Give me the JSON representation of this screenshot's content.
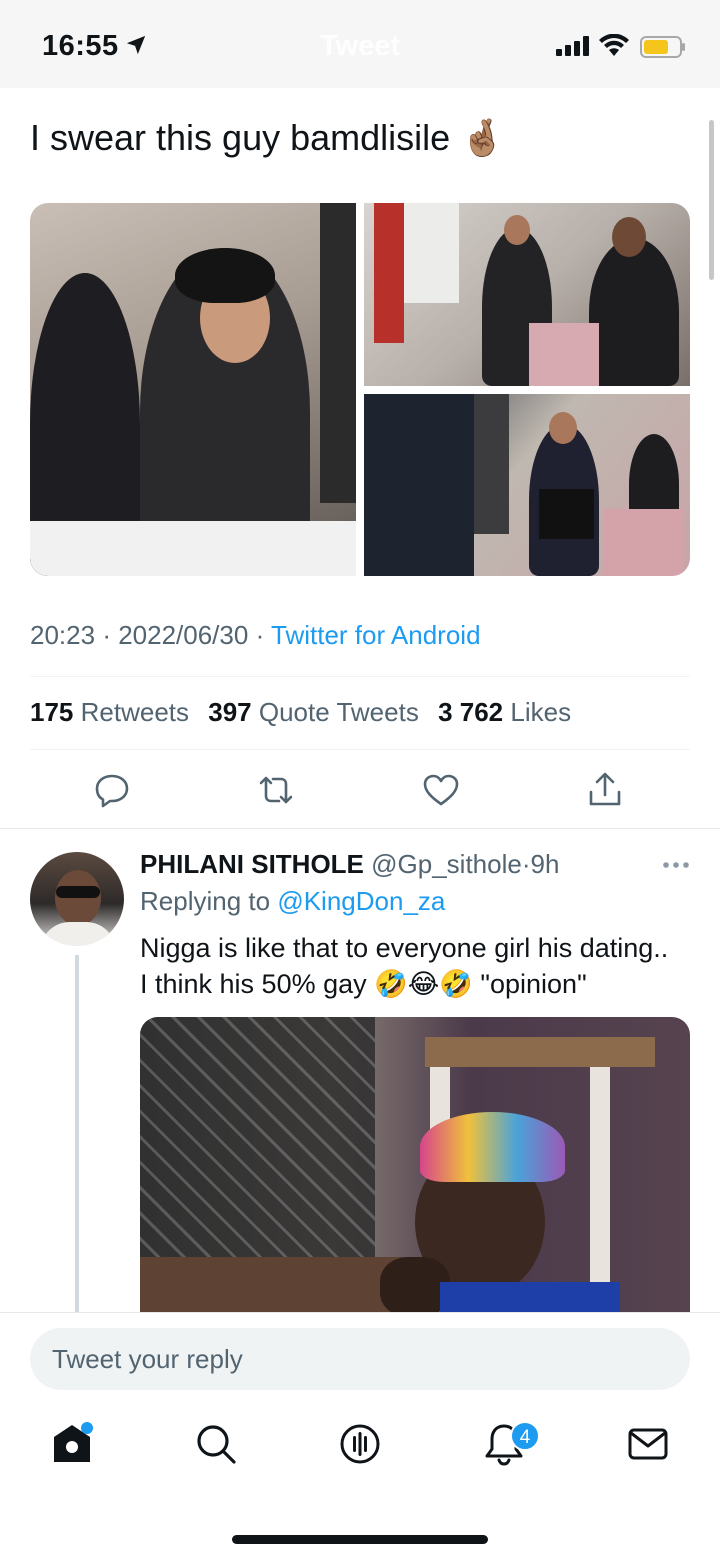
{
  "status_bar": {
    "time": "16:55",
    "title": "Tweet"
  },
  "tweet": {
    "text": "I swear this guy bamdlisile 🤞🏽",
    "time": "20:23",
    "date": "2022/06/30",
    "source": "Twitter for Android",
    "stats": {
      "retweets_count": "175",
      "retweets_label": "Retweets",
      "quotes_count": "397",
      "quotes_label": "Quote Tweets",
      "likes_count": "3 762",
      "likes_label": "Likes"
    }
  },
  "reply": {
    "name": "PHILANI SITHOLE",
    "handle": "@Gp_sithole",
    "age": "9h",
    "replying_prefix": "Replying to",
    "replying_handle": "@KingDon_za",
    "text_line1": "Nigga is like that to everyone girl his dating..",
    "text_line2": "I think his 50% gay 🤣😂🤣 \"opinion\""
  },
  "composer": {
    "placeholder": "Tweet your reply"
  },
  "tabbar": {
    "notifications_badge": "4"
  },
  "colors": {
    "accent": "#1d9bf0",
    "text": "#0f1419",
    "secondary": "#536471"
  }
}
